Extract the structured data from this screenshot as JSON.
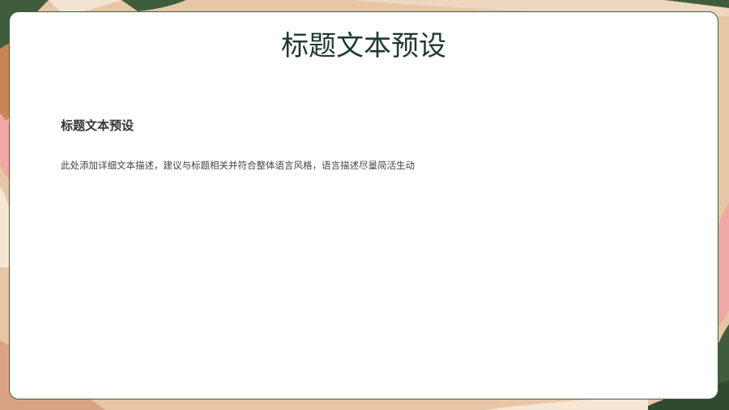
{
  "slide": {
    "title": "标题文本预设",
    "section": {
      "heading": "标题文本预设",
      "body": "此处添加详细文本描述，建议与标题相关并符合整体语言风格，语言描述尽量简活生动"
    }
  },
  "colors": {
    "background_peach": "#e7c6a6",
    "leaf_brown": "#c98556",
    "leaf_green": "#3f5d3c",
    "leaf_pink": "#f2a7a7",
    "card": "#ffffff",
    "title": "#1f3a2a"
  }
}
